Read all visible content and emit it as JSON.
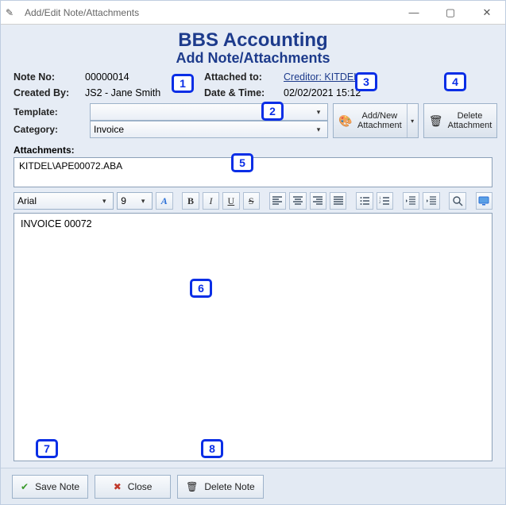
{
  "window": {
    "title": "Add/Edit Note/Attachments"
  },
  "header": {
    "app": "BBS Accounting",
    "subtitle": "Add Note/Attachments"
  },
  "info": {
    "note_no_label": "Note No:",
    "note_no": "00000014",
    "attached_to_label": "Attached to:",
    "attached_to": "Creditor: KITDEL",
    "created_by_label": "Created By:",
    "created_by": "JS2 - Jane Smith",
    "datetime_label": "Date & Time:",
    "datetime": "02/02/2021 15:12",
    "template_label": "Template:",
    "template_value": "",
    "category_label": "Category:",
    "category_value": "Invoice"
  },
  "buttons": {
    "add_attachment_l1": "Add/New",
    "add_attachment_l2": "Attachment",
    "delete_attachment_l1": "Delete",
    "delete_attachment_l2": "Attachment",
    "save": "Save Note",
    "close": "Close",
    "delete_note": "Delete Note"
  },
  "attachments": {
    "label": "Attachments:",
    "items": [
      "KITDEL\\APE00072.ABA"
    ]
  },
  "toolbar": {
    "font": "Arial",
    "size": "9"
  },
  "editor": {
    "body": "INVOICE 00072"
  },
  "callouts": {
    "c1": "1",
    "c2": "2",
    "c3": "3",
    "c4": "4",
    "c5": "5",
    "c6": "6",
    "c7": "7",
    "c8": "8"
  }
}
